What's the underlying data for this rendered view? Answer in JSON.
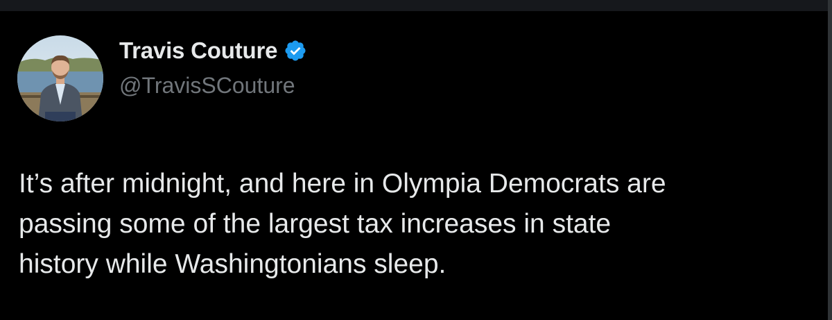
{
  "tweet": {
    "author": {
      "display_name": "Travis Couture",
      "handle": "@TravisSCouture",
      "verified": true,
      "avatar_icon": "profile-photo"
    },
    "text_lines": [
      "It’s after midnight, and here in Olympia Democrats are",
      "passing some of the largest tax increases in state",
      "history while Washingtonians sleep."
    ]
  },
  "colors": {
    "background": "#000000",
    "text_primary": "#e7e9ea",
    "text_secondary": "#71767b",
    "verified_badge": "#1d9bf0"
  }
}
